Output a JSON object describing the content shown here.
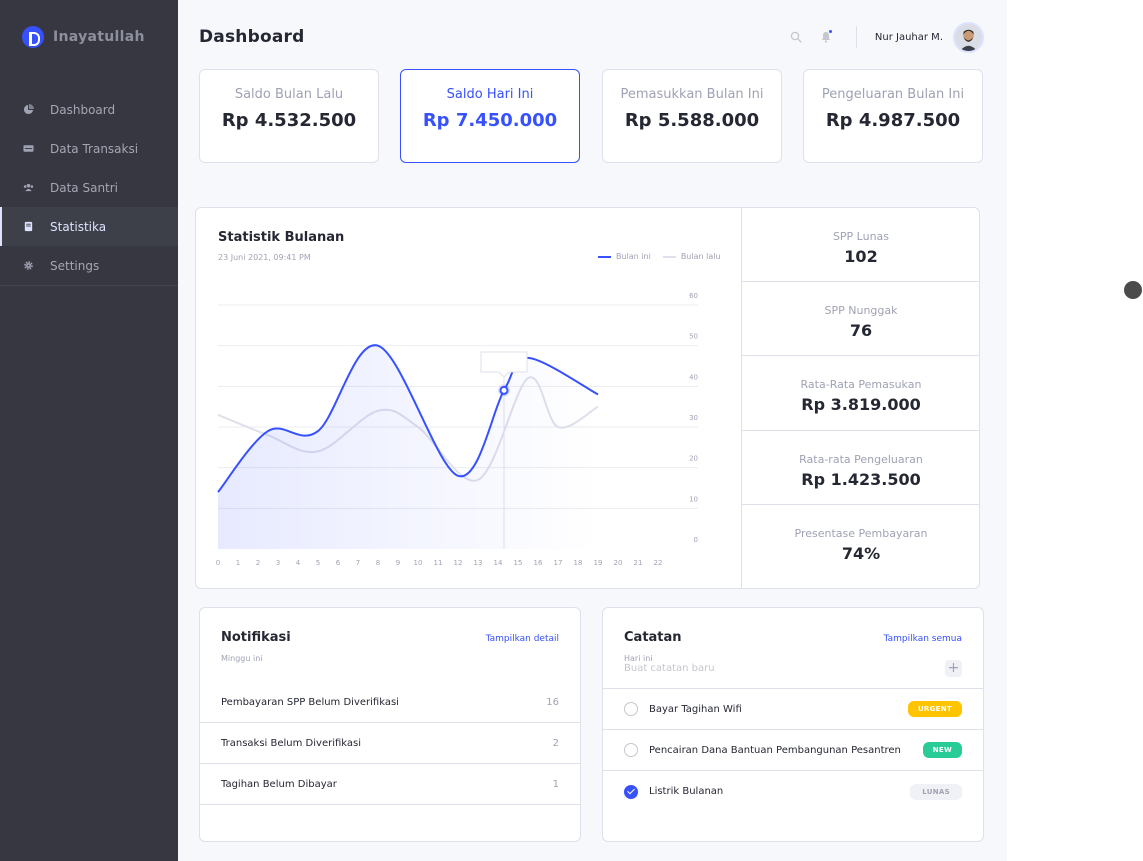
{
  "brand": {
    "name": "Inayatullah"
  },
  "sidebar": {
    "items": [
      {
        "label": "Dashboard",
        "icon": "pie-chart-icon",
        "active": false
      },
      {
        "label": "Data Transaksi",
        "icon": "ticket-icon",
        "active": false
      },
      {
        "label": "Data Santri",
        "icon": "users-icon",
        "active": false
      },
      {
        "label": "Statistika",
        "icon": "book-icon",
        "active": true
      },
      {
        "label": "Settings",
        "icon": "gear-icon",
        "active": false
      }
    ]
  },
  "header": {
    "title": "Dashboard",
    "user_name": "Nur Jauhar M."
  },
  "cards": [
    {
      "label": "Saldo Bulan Lalu",
      "value": "Rp 4.532.500"
    },
    {
      "label": "Saldo Hari Ini",
      "value": "Rp 7.450.000"
    },
    {
      "label": "Pemasukkan Bulan Ini",
      "value": "Rp 5.588.000"
    },
    {
      "label": "Pengeluaran Bulan Ini",
      "value": "Rp 4.987.500"
    }
  ],
  "chart_data": {
    "type": "line",
    "title": "Statistik Bulanan",
    "subtitle": "23 Juni 2021, 09:41 PM",
    "x": [
      0,
      1,
      2,
      3,
      4,
      5,
      6,
      7,
      8,
      9,
      10,
      11,
      12,
      13,
      14,
      15,
      16,
      17,
      18,
      19,
      20,
      21,
      22
    ],
    "x_ticks": [
      "0",
      "1",
      "2",
      "3",
      "4",
      "5",
      "6",
      "7",
      "8",
      "9",
      "10",
      "11",
      "12",
      "13",
      "14",
      "15",
      "16",
      "17",
      "18",
      "19",
      "20",
      "21",
      "22"
    ],
    "y_ticks": [
      "0",
      "10",
      "20",
      "30",
      "40",
      "50",
      "60"
    ],
    "ylim": [
      0,
      60
    ],
    "legend_position": "top-right",
    "grid": true,
    "series": [
      {
        "name": "Bulan ini",
        "color": "#3751ff",
        "points": [
          [
            0,
            14
          ],
          [
            2.5,
            29
          ],
          [
            5,
            29
          ],
          [
            8,
            50
          ],
          [
            12,
            18
          ],
          [
            14.3,
            39
          ],
          [
            15.5,
            47
          ],
          [
            19,
            38
          ]
        ]
      },
      {
        "name": "Bulan lalu",
        "color": "#dfe0eb",
        "points": [
          [
            0,
            33
          ],
          [
            2.5,
            28
          ],
          [
            5,
            24
          ],
          [
            8,
            34
          ],
          [
            10,
            30
          ],
          [
            13,
            17
          ],
          [
            15.5,
            42
          ],
          [
            17,
            30
          ],
          [
            19,
            35
          ]
        ]
      }
    ],
    "highlight_x": 14.3
  },
  "stats": [
    {
      "label": "SPP Lunas",
      "value": "102"
    },
    {
      "label": "SPP Nunggak",
      "value": "76"
    },
    {
      "label": "Rata-Rata Pemasukan",
      "value": "Rp 3.819.000"
    },
    {
      "label": "Rata-rata Pengeluaran",
      "value": "Rp 1.423.500"
    },
    {
      "label": "Presentase Pembayaran",
      "value": "74%"
    }
  ],
  "notifications": {
    "title": "Notifikasi",
    "subtitle": "Minggu ini",
    "link": "Tampilkan detail",
    "rows": [
      {
        "label": "Pembayaran SPP Belum Diverifikasi",
        "count": "16"
      },
      {
        "label": "Transaksi Belum Diverifikasi",
        "count": "2"
      },
      {
        "label": "Tagihan Belum Dibayar",
        "count": "1"
      }
    ]
  },
  "notes": {
    "title": "Catatan",
    "subtitle": "Hari ini",
    "link": "Tampilkan semua",
    "new_placeholder": "Buat catatan baru",
    "add_symbol": "+",
    "items": [
      {
        "label": "Bayar Tagihan Wifi",
        "checked": false,
        "badge": "URGENT"
      },
      {
        "label": "Pencairan Dana Bantuan Pembangunan Pesantren",
        "checked": false,
        "badge": "NEW"
      },
      {
        "label": "Listrik Bulanan",
        "checked": true,
        "badge": "LUNAS"
      }
    ]
  }
}
